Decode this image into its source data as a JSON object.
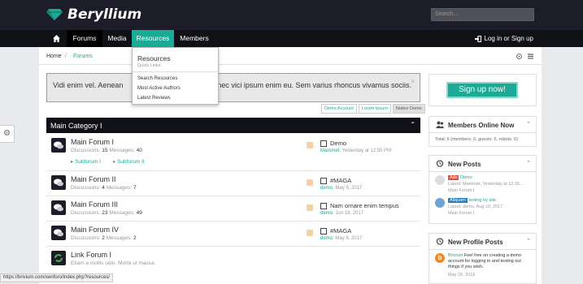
{
  "header": {
    "site_name": "Beryllium",
    "search_placeholder": "Search..."
  },
  "nav": {
    "items": [
      {
        "label": "Forums"
      },
      {
        "label": "Media"
      },
      {
        "label": "Resources"
      },
      {
        "label": "Members"
      }
    ],
    "login_label": "Log in or Sign up"
  },
  "breadcrumb": {
    "home": "Home",
    "sep": "/",
    "current": "Forums"
  },
  "dropdown": {
    "title": "Resources",
    "subtitle": "Quick Links",
    "items": [
      "Search Resources",
      "Most Active Authors",
      "Latest Reviews"
    ]
  },
  "notice": {
    "text_before": "Vidi enim vel. Aenean ",
    "text_after": "ciis donec vici ipsum enim eu. Sem varius rhoncus vivamus sociis.",
    "close": "×"
  },
  "notice_tabs": [
    "Demo Account",
    "Lorem Ipsum",
    "Notice Demo"
  ],
  "signup": {
    "label": "Sign up now!"
  },
  "category": {
    "title": "Main Category I"
  },
  "forums": [
    {
      "name": "Main Forum I",
      "disc_label": "Discussions:",
      "disc": "15",
      "msg_label": "Messages:",
      "msgs": "40",
      "subforums": [
        "Subforum I",
        "Subforum II"
      ],
      "latest_title": "Demo",
      "latest_user": "Mammet",
      "latest_date": "Yesterday at 12:55 PM"
    },
    {
      "name": "Main Forum II",
      "disc_label": "Discussions:",
      "disc": "4",
      "msg_label": "Messages:",
      "msgs": "7",
      "latest_title": "#MAGA",
      "latest_user": "demo",
      "latest_date": "May 9, 2017"
    },
    {
      "name": "Main Forum III",
      "disc_label": "Discussions:",
      "disc": "23",
      "msg_label": "Messages:",
      "msgs": "49",
      "latest_title": "Nam ornare enim tempus",
      "latest_user": "demo",
      "latest_date": "Jun 18, 2017"
    },
    {
      "name": "Main Forum IV",
      "disc_label": "Discussions:",
      "disc": "2",
      "msg_label": "Messages:",
      "msgs": "2",
      "latest_title": "#MAGA",
      "latest_user": "demo",
      "latest_date": "May 9, 2017"
    },
    {
      "name": "Link Forum I",
      "desc": "Etiam a mollis odio. Morbi ut massa."
    }
  ],
  "members_online": {
    "title": "Members Online Now",
    "total": "Total: 6 (members: 0, guests: 6, robots: 0)"
  },
  "new_posts": {
    "title": "New Posts",
    "items": [
      {
        "badge": "Ads",
        "badge_color": "#e74c3c",
        "title": "Demo",
        "meta": "Latest: Mammet, Yesterday at 12:35...",
        "forum": "Main Forum I"
      },
      {
        "badge": "Aliquam",
        "badge_color": "#2a7ab8",
        "title": "testing by site",
        "meta": "Latest: demo, Aug 10, 2017",
        "forum": "Main Forum I"
      }
    ]
  },
  "profile_posts": {
    "title": "New Profile Posts",
    "user": "Brivium",
    "text": "Feel free on creating a demo account for logging in and testing out things if you wish.",
    "date": "May 26, 2016"
  },
  "status_url": "https://brivium.com/xenforo/index.php?resources/",
  "colors": {
    "accent": "#1aaa96",
    "dark": "#1d1d29"
  }
}
